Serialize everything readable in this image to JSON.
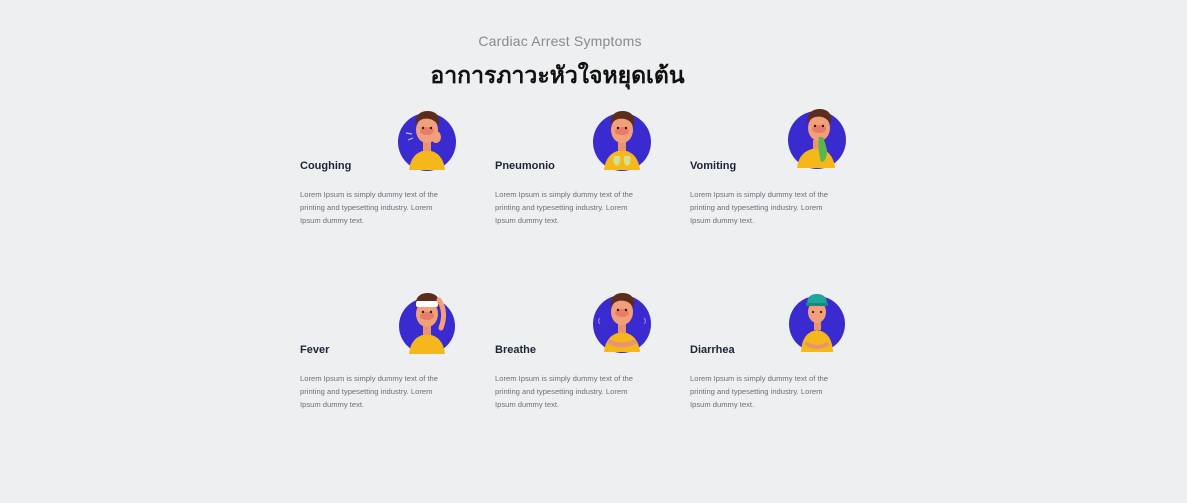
{
  "header": {
    "subtitle": "Cardiac Arrest Symptoms",
    "title": "อาการภาวะหัวใจหยุดเต้น"
  },
  "colors": {
    "avatar_bg": "#3a2bd1",
    "shirt": "#f4b81c",
    "skin": "#f1a07a",
    "hair": "#5a2e1a"
  },
  "symptoms": [
    {
      "name": "Coughing",
      "icon": "coughing-person-icon",
      "description": "Lorem Ipsum is simply dummy text of the printing and typesetting industry. Lorem Ipsum dummy text."
    },
    {
      "name": "Pneumonio",
      "icon": "pneumonia-person-icon",
      "description": "Lorem Ipsum is simply dummy text of the printing and typesetting industry. Lorem Ipsum dummy text."
    },
    {
      "name": "Vomiting",
      "icon": "vomiting-person-icon",
      "description": "Lorem Ipsum is simply dummy text of the printing and typesetting industry. Lorem Ipsum dummy text."
    },
    {
      "name": "Fever",
      "icon": "fever-person-icon",
      "description": "Lorem Ipsum is simply dummy text of the printing and typesetting industry. Lorem Ipsum dummy text."
    },
    {
      "name": "Breathe",
      "icon": "breathing-person-icon",
      "description": "Lorem Ipsum is simply dummy text of the printing and typesetting industry. Lorem Ipsum dummy text."
    },
    {
      "name": "Diarrhea",
      "icon": "diarrhea-person-icon",
      "description": "Lorem Ipsum is simply dummy text of the printing and typesetting industry. Lorem Ipsum dummy text."
    }
  ]
}
